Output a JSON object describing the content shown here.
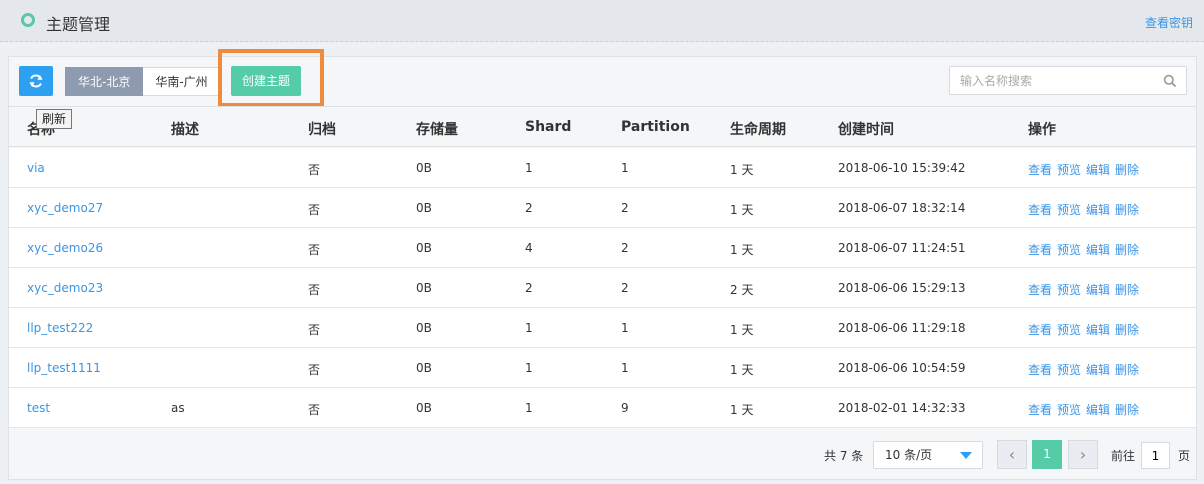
{
  "header": {
    "title": "主题管理",
    "key_link": "查看密钥",
    "accent_color": "#57c7ad"
  },
  "toolbar": {
    "refresh_tooltip": "刷新",
    "regions": [
      "华北-北京",
      "华南-广州"
    ],
    "active_region": "华北-北京",
    "create_label": "创建主题",
    "search_placeholder": "输入名称搜索",
    "search_value": ""
  },
  "table": {
    "columns": [
      "名称",
      "描述",
      "归档",
      "存储量",
      "Shard",
      "Partition",
      "生命周期",
      "创建时间",
      "操作"
    ],
    "rows": [
      {
        "name": "via",
        "desc": "",
        "archive": "否",
        "storage": "0B",
        "shard": "1",
        "partition": "1",
        "lifecycle": "1 天",
        "created": "2018-06-10 15:39:42"
      },
      {
        "name": "xyc_demo27",
        "desc": "",
        "archive": "否",
        "storage": "0B",
        "shard": "2",
        "partition": "2",
        "lifecycle": "1 天",
        "created": "2018-06-07 18:32:14"
      },
      {
        "name": "xyc_demo26",
        "desc": "",
        "archive": "否",
        "storage": "0B",
        "shard": "4",
        "partition": "2",
        "lifecycle": "1 天",
        "created": "2018-06-07 11:24:51"
      },
      {
        "name": "xyc_demo23",
        "desc": "",
        "archive": "否",
        "storage": "0B",
        "shard": "2",
        "partition": "2",
        "lifecycle": "2 天",
        "created": "2018-06-06 15:29:13"
      },
      {
        "name": "llp_test222",
        "desc": "",
        "archive": "否",
        "storage": "0B",
        "shard": "1",
        "partition": "1",
        "lifecycle": "1 天",
        "created": "2018-06-06 11:29:18"
      },
      {
        "name": "llp_test1111",
        "desc": "",
        "archive": "否",
        "storage": "0B",
        "shard": "1",
        "partition": "1",
        "lifecycle": "1 天",
        "created": "2018-06-06 10:54:59"
      },
      {
        "name": "test",
        "desc": "as",
        "archive": "否",
        "storage": "0B",
        "shard": "1",
        "partition": "9",
        "lifecycle": "1 天",
        "created": "2018-02-01 14:32:33"
      }
    ],
    "actions": [
      "查看",
      "预览",
      "编辑",
      "删除"
    ]
  },
  "pagination": {
    "total": "共 7 条",
    "page_size": "10 条/页",
    "prev": "‹",
    "next": "›",
    "current_page": "1",
    "goto_label": "前往",
    "goto_value": "1",
    "goto_unit": "页"
  }
}
